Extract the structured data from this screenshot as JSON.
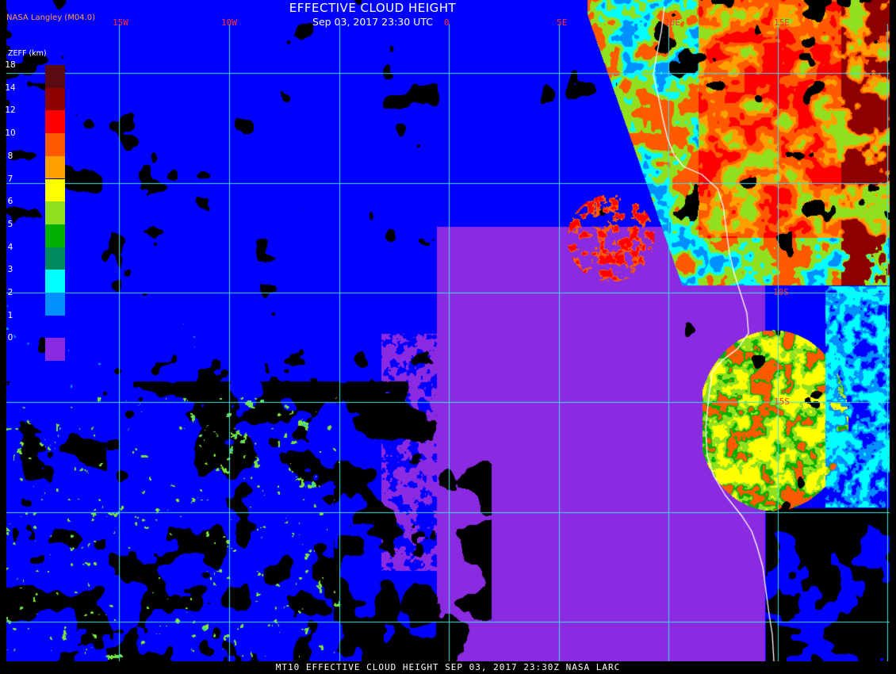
{
  "header": {
    "title": "EFFECTIVE CLOUD HEIGHT",
    "subtitle": "Sep 03, 2017 23:30 UTC",
    "producer": "NASA Langley (M04.0)"
  },
  "legend": {
    "unit_label": "ZEFF (km)",
    "ticks": [
      "18",
      "14",
      "12",
      "10",
      "8",
      "7",
      "6",
      "5",
      "4",
      "3",
      "2",
      "1",
      "0"
    ],
    "colors": [
      "#5a0a10",
      "#8c0000",
      "#ff0000",
      "#ff5a00",
      "#ffa000",
      "#ffff00",
      "#90e020",
      "#00b000",
      "#008a60",
      "#00ffff",
      "#0090ff",
      "#0000ff",
      "#8a2be2"
    ]
  },
  "map_labels": {
    "longitudes": [
      "15W",
      "10W",
      "0",
      "5E",
      "10E",
      "15E"
    ],
    "latitudes": [
      "10S",
      "15S"
    ]
  },
  "colors": {
    "grid": "#40e0e0",
    "coast": "#ffffff",
    "label": "#ff3030",
    "background": "#000000"
  },
  "footer": {
    "text": "MT10   EFFECTIVE CLOUD HEIGHT   SEP 03, 2017 23:30Z   NASA LARC"
  }
}
